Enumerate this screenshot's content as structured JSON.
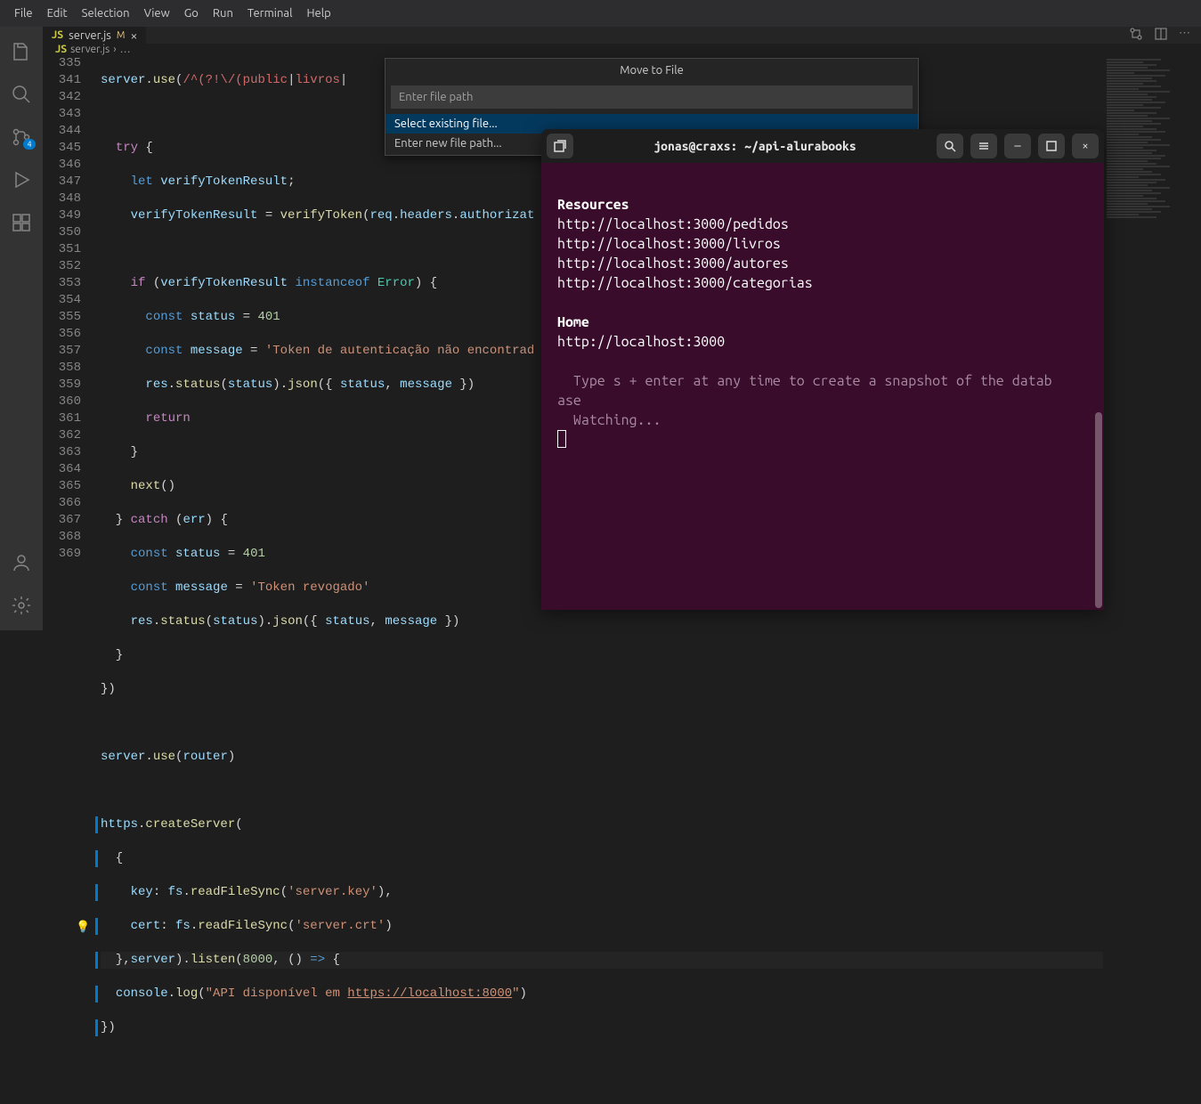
{
  "menubar": [
    "File",
    "Edit",
    "Selection",
    "View",
    "Go",
    "Run",
    "Terminal",
    "Help"
  ],
  "activity": {
    "scm_badge": "4"
  },
  "tab": {
    "icon": "JS",
    "name": "server.js",
    "modified": "M"
  },
  "breadcrumb": {
    "icon": "JS",
    "file": "server.js",
    "sep": "›",
    "more": "…"
  },
  "quick_input": {
    "title": "Move to File",
    "placeholder": "Enter file path",
    "items": [
      "Select existing file...",
      "Enter new file path..."
    ]
  },
  "gutter": [
    "335",
    "341",
    "342",
    "343",
    "344",
    "345",
    "346",
    "347",
    "348",
    "349",
    "350",
    "351",
    "352",
    "353",
    "354",
    "355",
    "356",
    "357",
    "358",
    "359",
    "360",
    "361",
    "362",
    "363",
    "364",
    "365",
    "366",
    "367",
    "368",
    "369"
  ],
  "terminal": {
    "title": "jonas@craxs: ~/api-alurabooks",
    "heading_resources": "Resources",
    "resources": [
      "http://localhost:3000/pedidos",
      "http://localhost:3000/livros",
      "http://localhost:3000/autores",
      "http://localhost:3000/categorias"
    ],
    "heading_home": "Home",
    "home": "http://localhost:3000",
    "hint1": "Type s + enter at any time to create a snapshot of the datab",
    "hint2": "ase",
    "watching": "Watching..."
  },
  "code": {
    "l335": "server.use(/^(?!\\/(public|livros|",
    "l342": "  try {",
    "l343": "    let verifyTokenResult;",
    "l344": "    verifyTokenResult = verifyToken(req.headers.authorizat",
    "l346": "    if (verifyTokenResult instanceof Error) {",
    "l347": "      const status = 401",
    "l348": "      const message = 'Token de autenticação não encontrad",
    "l349": "      res.status(status).json({ status, message })",
    "l350": "      return",
    "l351": "    }",
    "l352": "    next()",
    "l353": "  } catch (err) {",
    "l354": "    const status = 401",
    "l355": "    const message = 'Token revogado'",
    "l356": "    res.status(status).json({ status, message })",
    "l357": "  }",
    "l358": "})",
    "l360": "server.use(router)",
    "l362": "https.createServer(",
    "l363": "  {",
    "l364": "    key: fs.readFileSync('server.key'),",
    "l365": "    cert: fs.readFileSync('server.crt')",
    "l366": "  },server).listen(8000, () => {",
    "l367": "  console.log(\"API disponível em https://localhost:8000\")",
    "l368": "})"
  }
}
